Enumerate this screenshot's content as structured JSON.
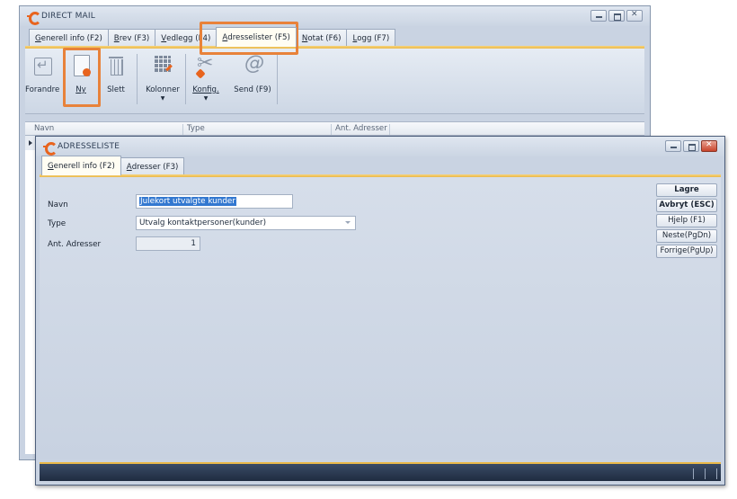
{
  "main_window": {
    "title": "DIRECT MAIL",
    "tabs": [
      {
        "label": "Generell info (F2)",
        "hot": "G",
        "rest": "enerell info (F2)",
        "active": false
      },
      {
        "label": "Brev (F3)",
        "hot": "B",
        "rest": "rev (F3)",
        "active": false
      },
      {
        "label": "Vedlegg (F4)",
        "hot": "V",
        "rest": "edlegg (F4)",
        "active": false
      },
      {
        "label": "Adresselister (F5)",
        "hot": "A",
        "rest": "dresselister (F5)",
        "active": true
      },
      {
        "label": "Notat (F6)",
        "hot": "N",
        "rest": "otat (F6)",
        "active": false
      },
      {
        "label": "Logg (F7)",
        "hot": "L",
        "rest": "ogg (F7)",
        "active": false
      }
    ],
    "ribbon": {
      "forandre": "Forandre",
      "ny": "Ny",
      "slett": "Slett",
      "kolonner": "Kolonner",
      "konfig": "Konfig.",
      "send": "Send (F9)"
    },
    "grid_columns": [
      "Navn",
      "Type",
      "Ant. Adresser"
    ]
  },
  "dialog": {
    "title": "ADRESSELISTE",
    "tabs": [
      {
        "label": "Generell info (F2)",
        "hot": "G",
        "rest": "enerell info (F2)",
        "active": true
      },
      {
        "label": "Adresser (F3)",
        "hot": "A",
        "rest": "dresser (F3)",
        "active": false
      }
    ],
    "fields": {
      "navn_label": "Navn",
      "navn_value": "Julekort utvalgte kunder",
      "type_label": "Type",
      "type_value": "Utvalg kontaktpersoner(kunder)",
      "ant_label": "Ant. Adresser",
      "ant_value": "1"
    },
    "buttons": {
      "lagre": "Lagre",
      "avbryt": "Avbryt (ESC)",
      "hjelp": "Hjelp (F1)",
      "neste": "Neste(PgDn)",
      "forrige": "Forrige(PgUp)"
    }
  },
  "colors": {
    "accent_orange": "#e8641e",
    "highlight_orange": "#e8823a",
    "active_tab_line": "#eab94a",
    "selection_blue": "#3378d0"
  }
}
